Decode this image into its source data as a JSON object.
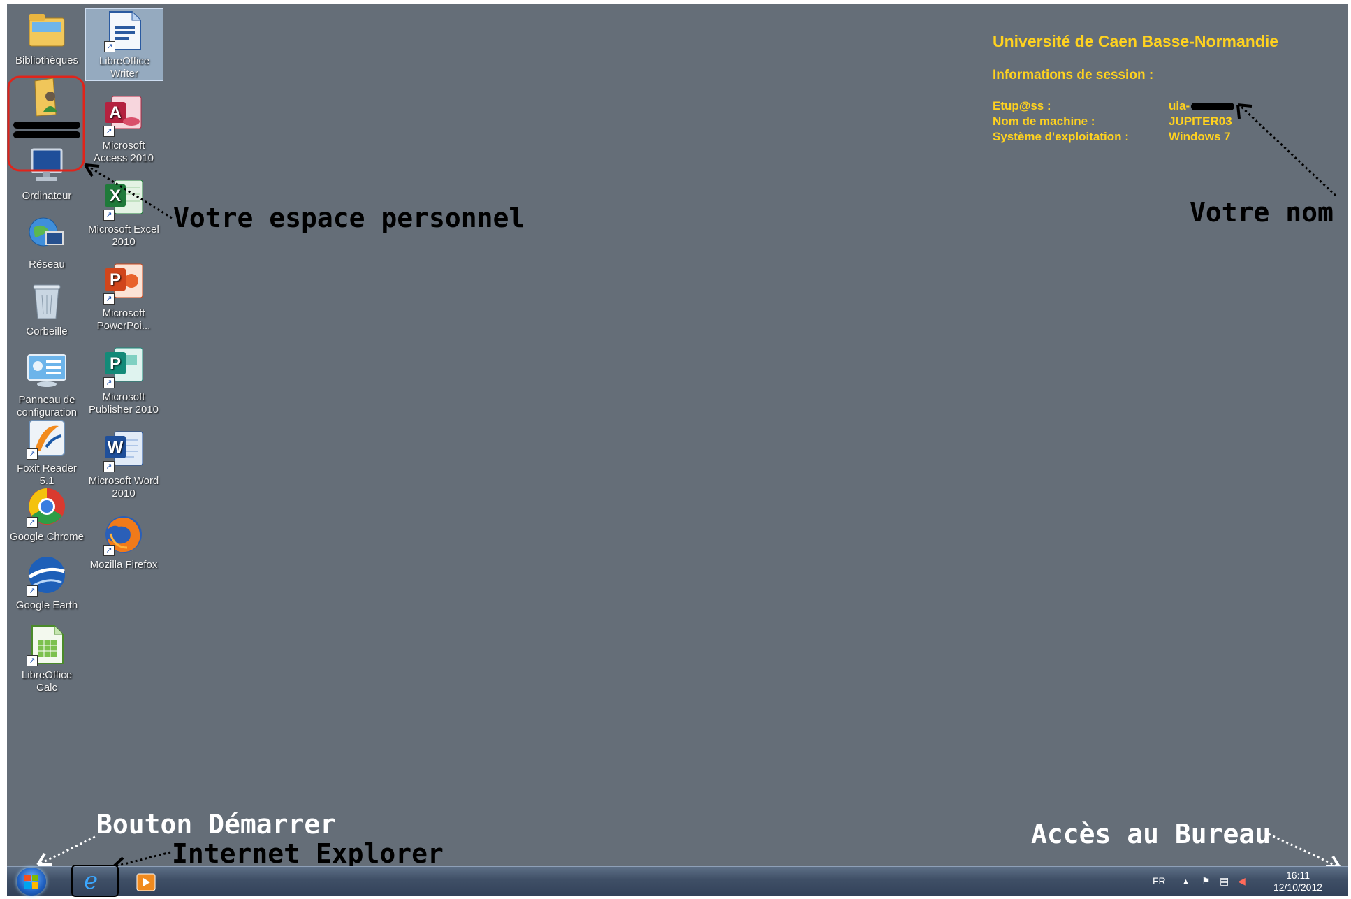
{
  "desktop": {
    "icons": [
      {
        "label": "Bibliothèques",
        "icon": "libraries-folder-icon"
      },
      {
        "label": "LibreOffice Writer",
        "icon": "libreoffice-writer-icon"
      },
      {
        "label": "",
        "icon": "personal-folder-icon"
      },
      {
        "label": "Microsoft Access 2010",
        "icon": "access-icon"
      },
      {
        "label": "Ordinateur",
        "icon": "computer-icon"
      },
      {
        "label": "Microsoft Excel 2010",
        "icon": "excel-icon"
      },
      {
        "label": "Réseau",
        "icon": "network-icon"
      },
      {
        "label": "Microsoft PowerPoi...",
        "icon": "powerpoint-icon"
      },
      {
        "label": "Corbeille",
        "icon": "recycle-bin-icon"
      },
      {
        "label": "Microsoft Publisher 2010",
        "icon": "publisher-icon"
      },
      {
        "label": "Panneau de configuration",
        "icon": "control-panel-icon"
      },
      {
        "label": "Microsoft Word 2010",
        "icon": "word-icon"
      },
      {
        "label": "Foxit Reader 5.1",
        "icon": "foxit-reader-icon"
      },
      {
        "label": "Mozilla Firefox",
        "icon": "firefox-icon"
      },
      {
        "label": "Google Chrome",
        "icon": "chrome-icon"
      },
      {
        "label": "Google Earth",
        "icon": "google-earth-icon"
      },
      {
        "label": "LibreOffice Calc",
        "icon": "libreoffice-calc-icon"
      }
    ]
  },
  "session": {
    "university": "Université de Caen Basse-Normandie",
    "heading": "Informations de session :",
    "rows": [
      {
        "key": "Etup@ss :",
        "value": "uia-"
      },
      {
        "key": "Nom de machine :",
        "value": "JUPITER03"
      },
      {
        "key": "Système d'exploitation :",
        "value": "Windows 7"
      }
    ]
  },
  "annotations": {
    "personal_space": "Votre espace personnel",
    "your_name": "Votre nom",
    "start_button": "Bouton Démarrer",
    "internet_explorer": "Internet Explorer",
    "desktop_access": "Accès au Bureau"
  },
  "taskbar": {
    "language": "FR",
    "time": "16:11",
    "date": "12/10/2012"
  },
  "colors": {
    "desktop_bg": "#656e78",
    "session_text": "#ffd21f"
  }
}
